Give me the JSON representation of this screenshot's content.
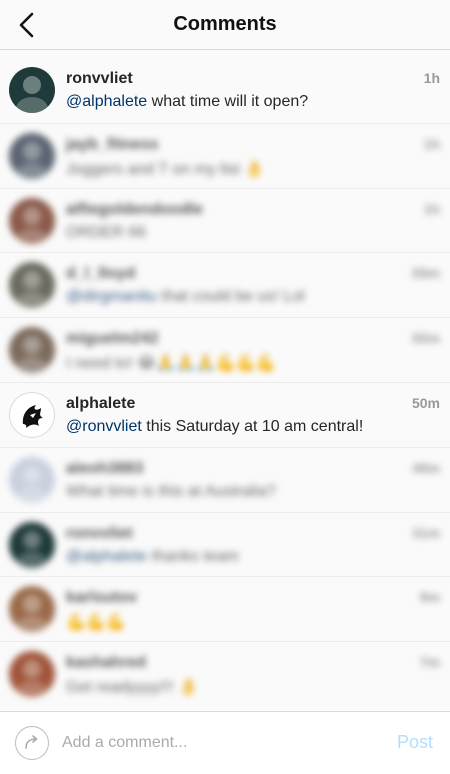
{
  "header": {
    "title": "Comments",
    "back_icon": "chevron-left-icon"
  },
  "comments": [
    {
      "username": "ronvvliet",
      "mention": "@alphalete",
      "text": " what time will it open?",
      "time": "1h",
      "blurred": false,
      "avatar_bg": "#1f3a3a"
    },
    {
      "username": "jayb_fitness",
      "mention": "",
      "text": "Joggers and T on my list 👌",
      "time": "1h",
      "blurred": true,
      "avatar_bg": "#5a6472"
    },
    {
      "username": "alfiegoldendoodle",
      "mention": "",
      "text": "ORDER 66",
      "time": "1h",
      "blurred": true,
      "avatar_bg": "#8a5a4a"
    },
    {
      "username": "d_l_lloyd",
      "mention": "@dirgmanitu",
      "text": " that could be us! Lol",
      "time": "59m",
      "blurred": true,
      "avatar_bg": "#6b6a5e"
    },
    {
      "username": "miguelm242",
      "mention": "",
      "text": "I need to! 😂🙏🙏🙏💪💪💪",
      "time": "55m",
      "blurred": true,
      "avatar_bg": "#7c6a5c"
    },
    {
      "username": "alphalete",
      "mention": "@ronvvliet",
      "text": " this Saturday at 10 am central!",
      "time": "50m",
      "blurred": false,
      "avatar_bg": "#ffffff"
    },
    {
      "username": "aleoh3883",
      "mention": "",
      "text": "What time is this at Australia?",
      "time": "49m",
      "blurred": true,
      "avatar_bg": "#c8d0de"
    },
    {
      "username": "ronvvliet",
      "mention": "@alphalete",
      "text": " thanks team",
      "time": "31m",
      "blurred": true,
      "avatar_bg": "#1f3a3a"
    },
    {
      "username": "karlsutov",
      "mention": "",
      "text": "💪💪💪",
      "time": "9m",
      "blurred": true,
      "avatar_bg": "#9a6a4a"
    },
    {
      "username": "kashahred",
      "mention": "",
      "text": "Get readyyyy!!! 👌",
      "time": "7m",
      "blurred": true,
      "avatar_bg": "#a0553a"
    }
  ],
  "composer": {
    "placeholder": "Add a comment...",
    "post_label": "Post",
    "avatar_icon": "share-arrow-icon"
  },
  "colors": {
    "mention": "#003569",
    "post_disabled": "#b2dffc",
    "time": "#999999"
  }
}
